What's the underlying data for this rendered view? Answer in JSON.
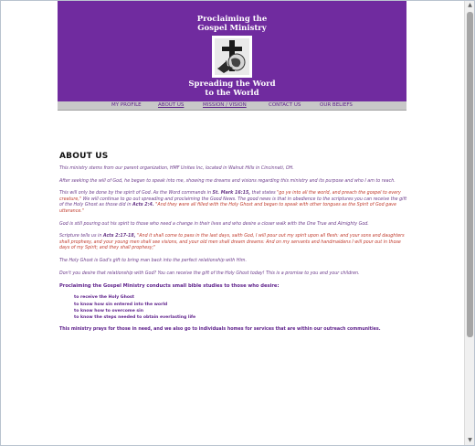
{
  "header": {
    "title_line1": "Proclaiming the",
    "title_line2": "Gospel Ministry",
    "subtitle_line1": "Spreading the Word",
    "subtitle_line2": "to the World",
    "color": "#702b9f"
  },
  "nav": {
    "items": [
      {
        "label": "MY PROFILE"
      },
      {
        "label": "ABOUT US"
      },
      {
        "label": "MISSION / VISION"
      },
      {
        "label": "CONTACT US"
      },
      {
        "label": "OUR BELIEFS"
      }
    ]
  },
  "main": {
    "heading": "ABOUT US",
    "p1": "This ministry stems from our parent organization, HMF Unites Inc, located in Walnut Hills in Cincinnati, OH.",
    "p2": "After seeking the will of God, he began to speak into me, showing me dreams and visions regarding this ministry and its purpose and who I am to reach.",
    "p3_a": "This will only be done by the spirit of God. As the Word commands in ",
    "p3_ref1": "St. Mark 16:15,",
    "p3_b": " that states ",
    "p3_q1": "\"go ye into all the world, and preach the gospel to every creature,\"",
    "p3_c": " We will continue to go out spreading and proclaiming the Good News. The good news is that in obedience to the scriptures you can receive the gift of the Holy Ghost as those did in ",
    "p3_ref2": "Acts 2:4.",
    "p3_q2": " \"And they were all filled with the Holy Ghost and began to speak with other tongues as the Spirit of God gave utterance.\"",
    "p4": "God is still pouring out his spirit to those who need a change in their lives and who desire a closer walk with the One True and Almighty God.",
    "p5_a": "Scripture tells us in ",
    "p5_ref": "Acts 2:17-18,",
    "p5_q": " \"And it shall come to pass in the last days, saith God, I will pour out my spirit upon all flesh: and your sons and daughters shall prophesy, and your young men shall see visions, and your old men shall dream dreams: And on my servants and handmaidens I will pour out in those days of my Spirit; and they shall prophesy;\"",
    "p6": "The Holy Ghost is God's gift to bring man back into the perfect relationship with Him.",
    "p7": "Don't you desire that relationship with God? You can receive the gift of the Holy Ghost today! This is a promise to you and your children.",
    "studies_heading": "Proclaiming the Gospel Ministry conducts small bible studies to those who desire:",
    "studies": [
      "to receive the Holy Ghost",
      "to know how sin entered into the world",
      "to know how to overcome sin",
      "to know the steps needed to obtain everlasting life"
    ],
    "closing": "This ministry prays for those in need, and we also go to individuals homes for services that are within our outreach communities."
  },
  "scrollbar": {
    "up_icon": "▲",
    "down_icon": "▼"
  }
}
